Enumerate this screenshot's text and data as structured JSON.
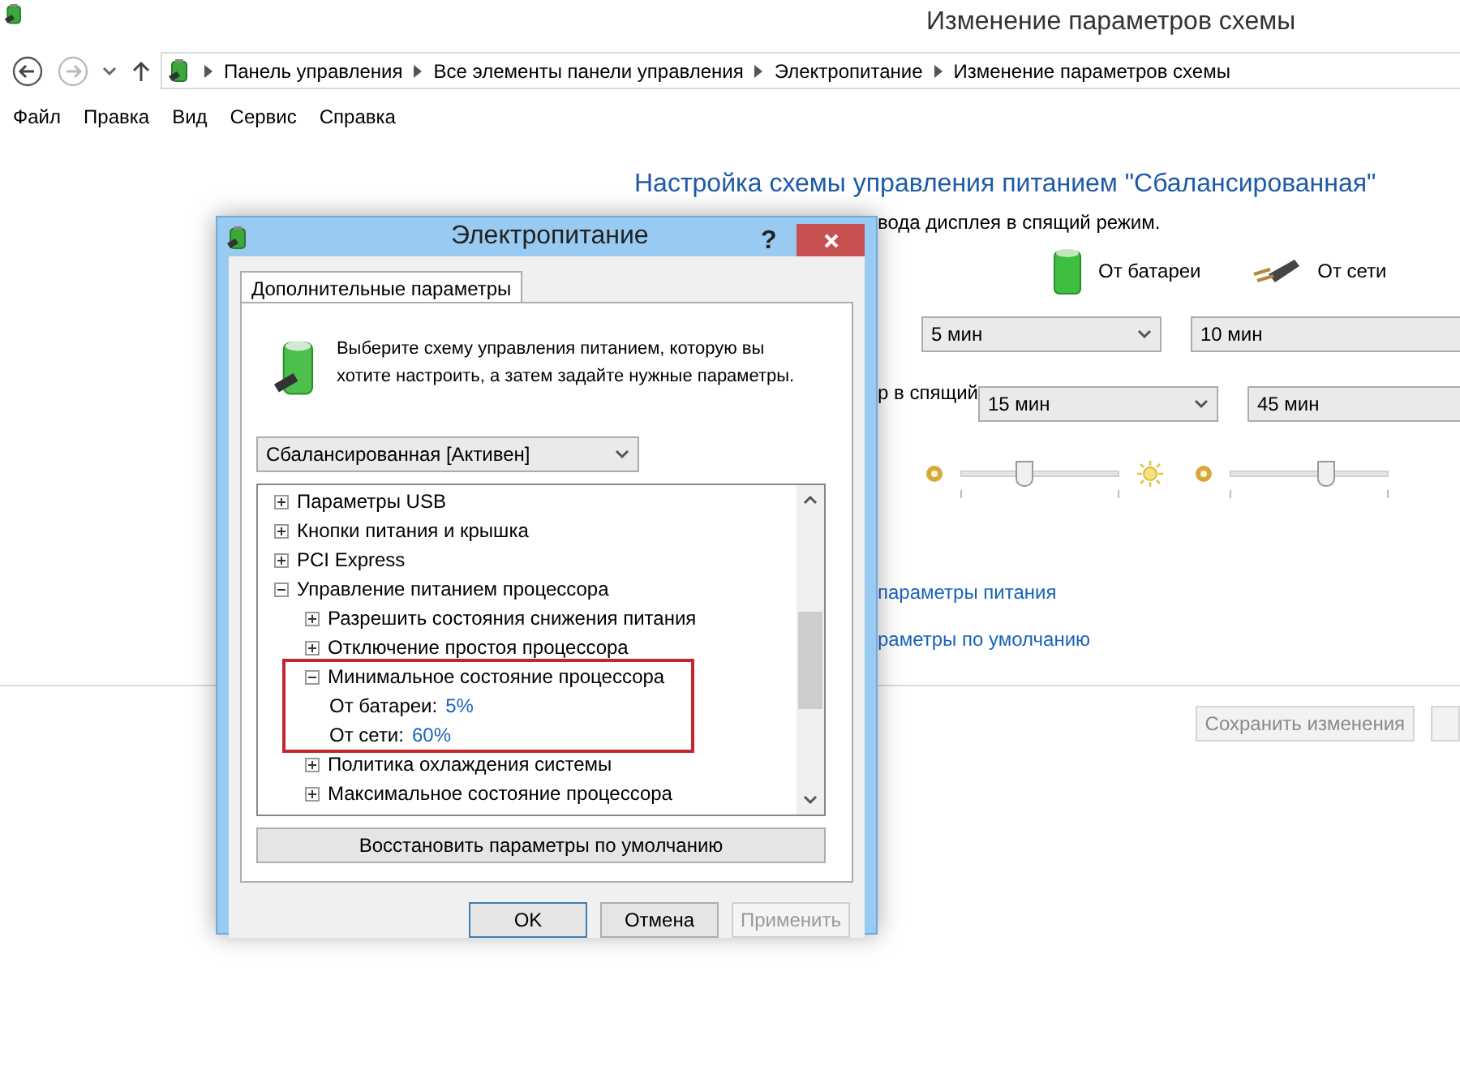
{
  "window": {
    "title": "Изменение параметров схемы"
  },
  "nav": {
    "back_disabled": false,
    "forward_disabled": true
  },
  "breadcrumbs": [
    "Панель управления",
    "Все элементы панели управления",
    "Электропитание",
    "Изменение параметров схемы"
  ],
  "menu": [
    "Файл",
    "Правка",
    "Вид",
    "Сервис",
    "Справка"
  ],
  "main": {
    "heading": "Настройка схемы управления питанием \"Сбалансированная\"",
    "description_fragment": "вода дисплея в спящий режим.",
    "columns": [
      {
        "kind": "battery",
        "label": "От батареи"
      },
      {
        "kind": "plug",
        "label": "От сети"
      }
    ],
    "rows": [
      {
        "kind": "select",
        "label_fragment": null,
        "values": [
          "5 мин",
          "10 мин"
        ]
      },
      {
        "kind": "select",
        "label_fragment": "р в спящий",
        "values": [
          "15 мин",
          "45 мин"
        ]
      },
      {
        "kind": "slider",
        "label_fragment": null,
        "sliders": [
          {
            "level": 0.4
          },
          {
            "level": 0.6
          }
        ]
      }
    ],
    "links": [
      "параметры питания",
      "раметры по умолчанию"
    ],
    "save_button": {
      "label": "Сохранить изменения",
      "disabled": true
    }
  },
  "dialog": {
    "title": "Электропитание",
    "help": "?",
    "tab": {
      "label": "Дополнительные параметры",
      "selected": true
    },
    "intro": "Выберите схему управления питанием, которую вы хотите настроить, а затем задайте нужные параметры.",
    "scheme": "Сбалансированная [Активен]",
    "tree": [
      {
        "kind": "group",
        "label": "Параметры USB",
        "expanded": false,
        "highlighted": false
      },
      {
        "kind": "group",
        "label": "Кнопки питания и крышка",
        "expanded": false,
        "highlighted": false
      },
      {
        "kind": "group",
        "label": "PCI Express",
        "expanded": false,
        "highlighted": false
      },
      {
        "kind": "group",
        "label": "Управление питанием процессора",
        "expanded": true,
        "highlighted": false,
        "children": [
          {
            "kind": "group",
            "label": "Разрешить состояния снижения питания",
            "expanded": false,
            "highlighted": false
          },
          {
            "kind": "group",
            "label": "Отключение простоя процессора",
            "expanded": false,
            "highlighted": false
          },
          {
            "kind": "group",
            "label": "Минимальное состояние процессора",
            "expanded": true,
            "highlighted": true,
            "children": [
              {
                "kind": "setting",
                "label": "От батареи:",
                "value": "5%"
              },
              {
                "kind": "setting",
                "label": "От сети:",
                "value": "60%"
              }
            ]
          },
          {
            "kind": "group",
            "label": "Политика охлаждения системы",
            "expanded": false,
            "highlighted": false
          },
          {
            "kind": "group",
            "label": "Максимальное состояние процессора",
            "expanded": false,
            "highlighted": false
          }
        ]
      }
    ],
    "restore_button": "Восстановить параметры по умолчанию",
    "buttons": [
      {
        "label": "OK",
        "default": true,
        "disabled": false
      },
      {
        "label": "Отмена",
        "default": false,
        "disabled": false
      },
      {
        "label": "Применить",
        "default": false,
        "disabled": true
      }
    ]
  }
}
